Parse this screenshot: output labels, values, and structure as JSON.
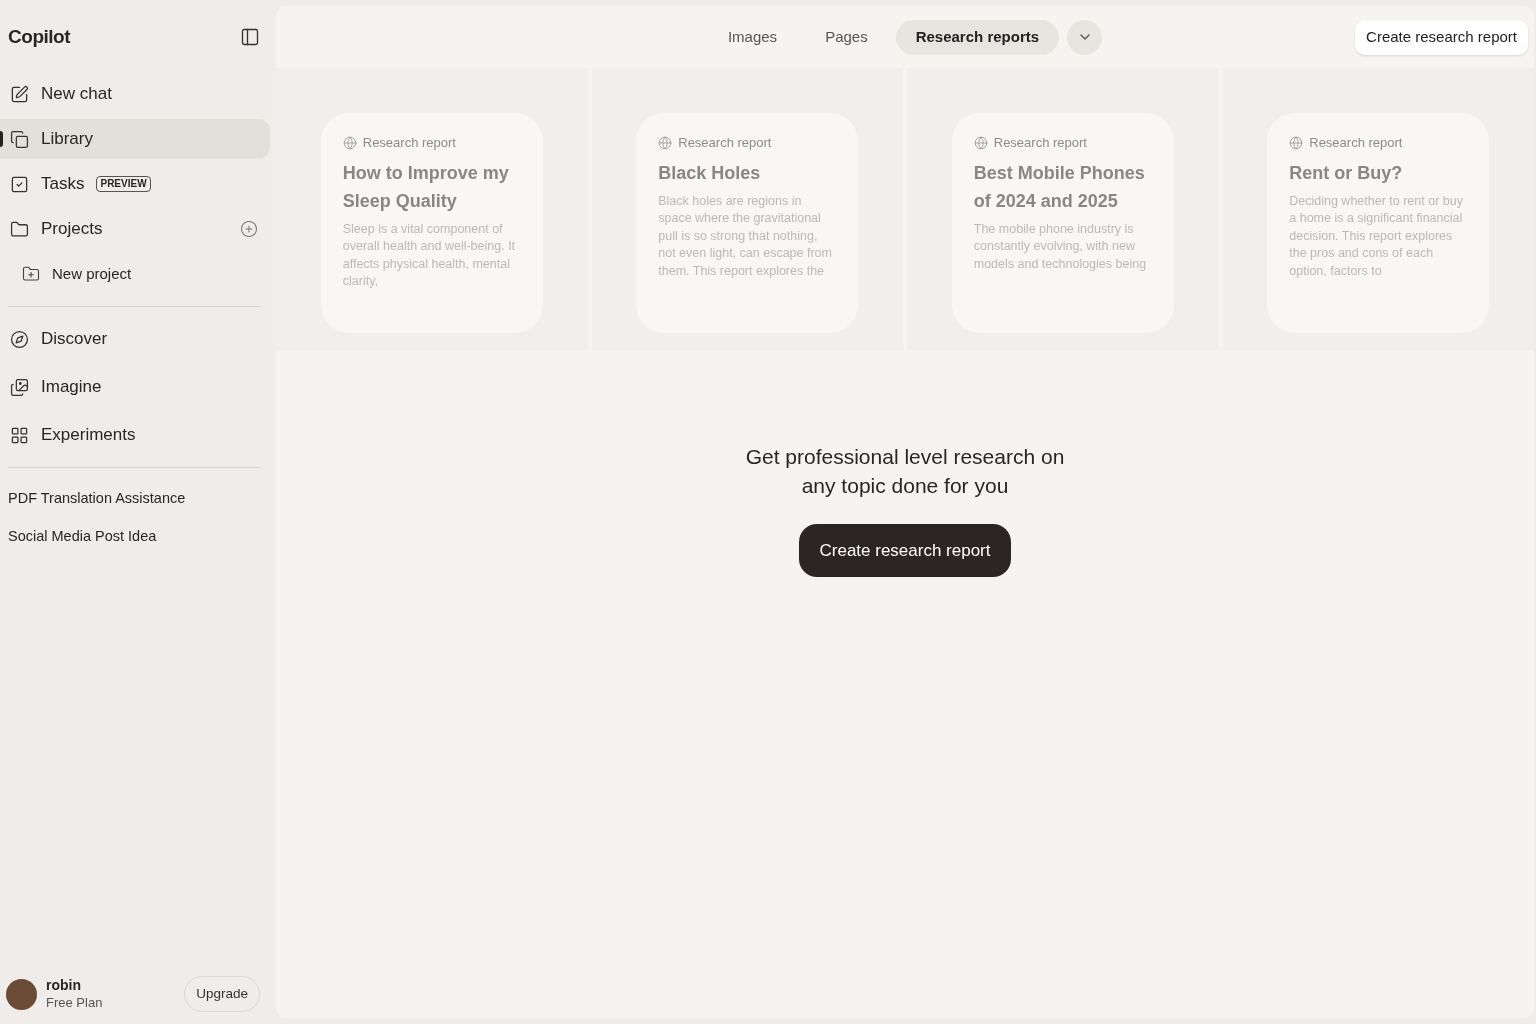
{
  "sidebar": {
    "brand": "Copilot",
    "nav": [
      {
        "label": "New chat",
        "selected": false
      },
      {
        "label": "Library",
        "selected": true
      },
      {
        "label": "Tasks",
        "badge": "PREVIEW",
        "selected": false
      },
      {
        "label": "Projects",
        "selected": false,
        "add": true
      }
    ],
    "sub_item": "New project",
    "nav2": [
      {
        "label": "Discover"
      },
      {
        "label": "Imagine"
      },
      {
        "label": "Experiments"
      }
    ],
    "history": [
      "PDF Translation Assistance",
      "Social Media Post Idea"
    ],
    "user": {
      "name": "robin",
      "plan": "Free Plan",
      "button": "Upgrade"
    }
  },
  "tabs": [
    {
      "label": "Images",
      "selected": false
    },
    {
      "label": "Pages",
      "selected": false
    },
    {
      "label": "Research reports",
      "selected": true
    }
  ],
  "header_button": "Create research report",
  "cards": [
    {
      "tag": "Research report",
      "title": "How to Improve my Sleep Quality",
      "body": "Sleep is a vital component of overall health and well-being. It affects physical health, mental clarity,"
    },
    {
      "tag": "Research report",
      "title": "Black Holes",
      "body": "Black holes are regions in space where the gravitational pull is so strong that nothing, not even light, can escape from them. This report explores the"
    },
    {
      "tag": "Research report",
      "title": "Best Mobile Phones of 2024 and 2025",
      "body": "The mobile phone industry is constantly evolving, with new models and technologies being"
    },
    {
      "tag": "Research report",
      "title": "Rent or Buy?",
      "body": "Deciding whether to rent or buy a home is a significant financial decision. This report explores the pros and cons of each option, factors to"
    }
  ],
  "promo": {
    "headline": "Get professional level research on any topic done for you",
    "button": "Create research report"
  }
}
